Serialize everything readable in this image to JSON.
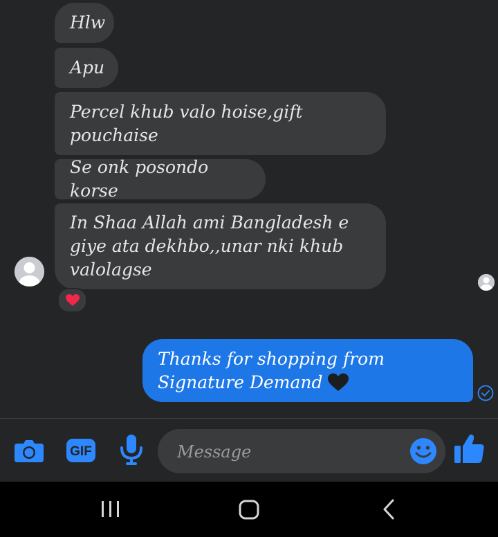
{
  "messages": [
    {
      "text": "Hlw"
    },
    {
      "text": "Apu"
    },
    {
      "text": "Percel khub valo hoise,gift pouchaise"
    },
    {
      "text": "Se onk posondo korse"
    },
    {
      "text": "In Shaa Allah ami Bangladesh e giye ata dekhbo,,unar nki khub valolagse"
    }
  ],
  "sent_message": {
    "text": "Thanks for shopping from Signature Demand"
  },
  "sent_emoji": "black-heart",
  "reaction_icon": "red-heart-icon",
  "composer": {
    "placeholder": "Message",
    "gif_label": "GIF",
    "icons": [
      "camera-icon",
      "gif-icon",
      "microphone-icon",
      "emoji-icon",
      "thumbs-up-icon"
    ]
  },
  "navigation": [
    "recent-apps-icon",
    "home-icon",
    "back-icon"
  ],
  "colors": {
    "background": "#242526",
    "incoming_bubble": "#3a3b3c",
    "outgoing_bubble": "#1e77e7",
    "accent": "#2d88ff",
    "text": "#e4e6eb"
  }
}
